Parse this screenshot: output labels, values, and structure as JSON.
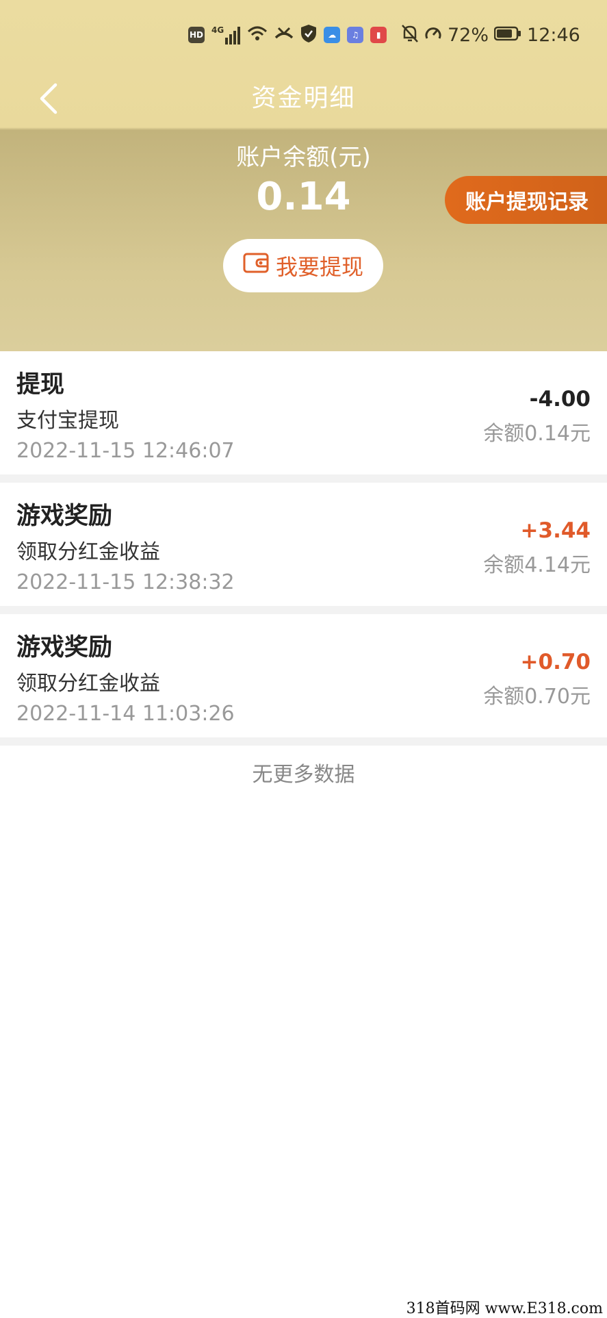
{
  "status_bar": {
    "hd": "HD",
    "network": "4G",
    "battery_percent": "72%",
    "time": "12:46"
  },
  "header": {
    "title": "资金明细"
  },
  "balance": {
    "label": "账户余额(元)",
    "value": "0.14"
  },
  "buttons": {
    "records_label": "账户提现记录",
    "withdraw_label": "我要提现"
  },
  "colors": {
    "header_bg": "#e9d99c",
    "accent_orange": "#e0602a",
    "positive": "#e05a2a",
    "negative": "#222222"
  },
  "transactions": [
    {
      "title": "提现",
      "desc": "支付宝提现",
      "time": "2022-11-15 12:46:07",
      "amount": "-4.00",
      "balance": "余额0.14元",
      "type": "negative"
    },
    {
      "title": "游戏奖励",
      "desc": "领取分红金收益",
      "time": "2022-11-15 12:38:32",
      "amount": "+3.44",
      "balance": "余额4.14元",
      "type": "positive"
    },
    {
      "title": "游戏奖励",
      "desc": "领取分红金收益",
      "time": "2022-11-14 11:03:26",
      "amount": "+0.70",
      "balance": "余额0.70元",
      "type": "positive"
    }
  ],
  "footer": {
    "no_more": "无更多数据"
  },
  "watermark": "318首码网 www.E318.com"
}
